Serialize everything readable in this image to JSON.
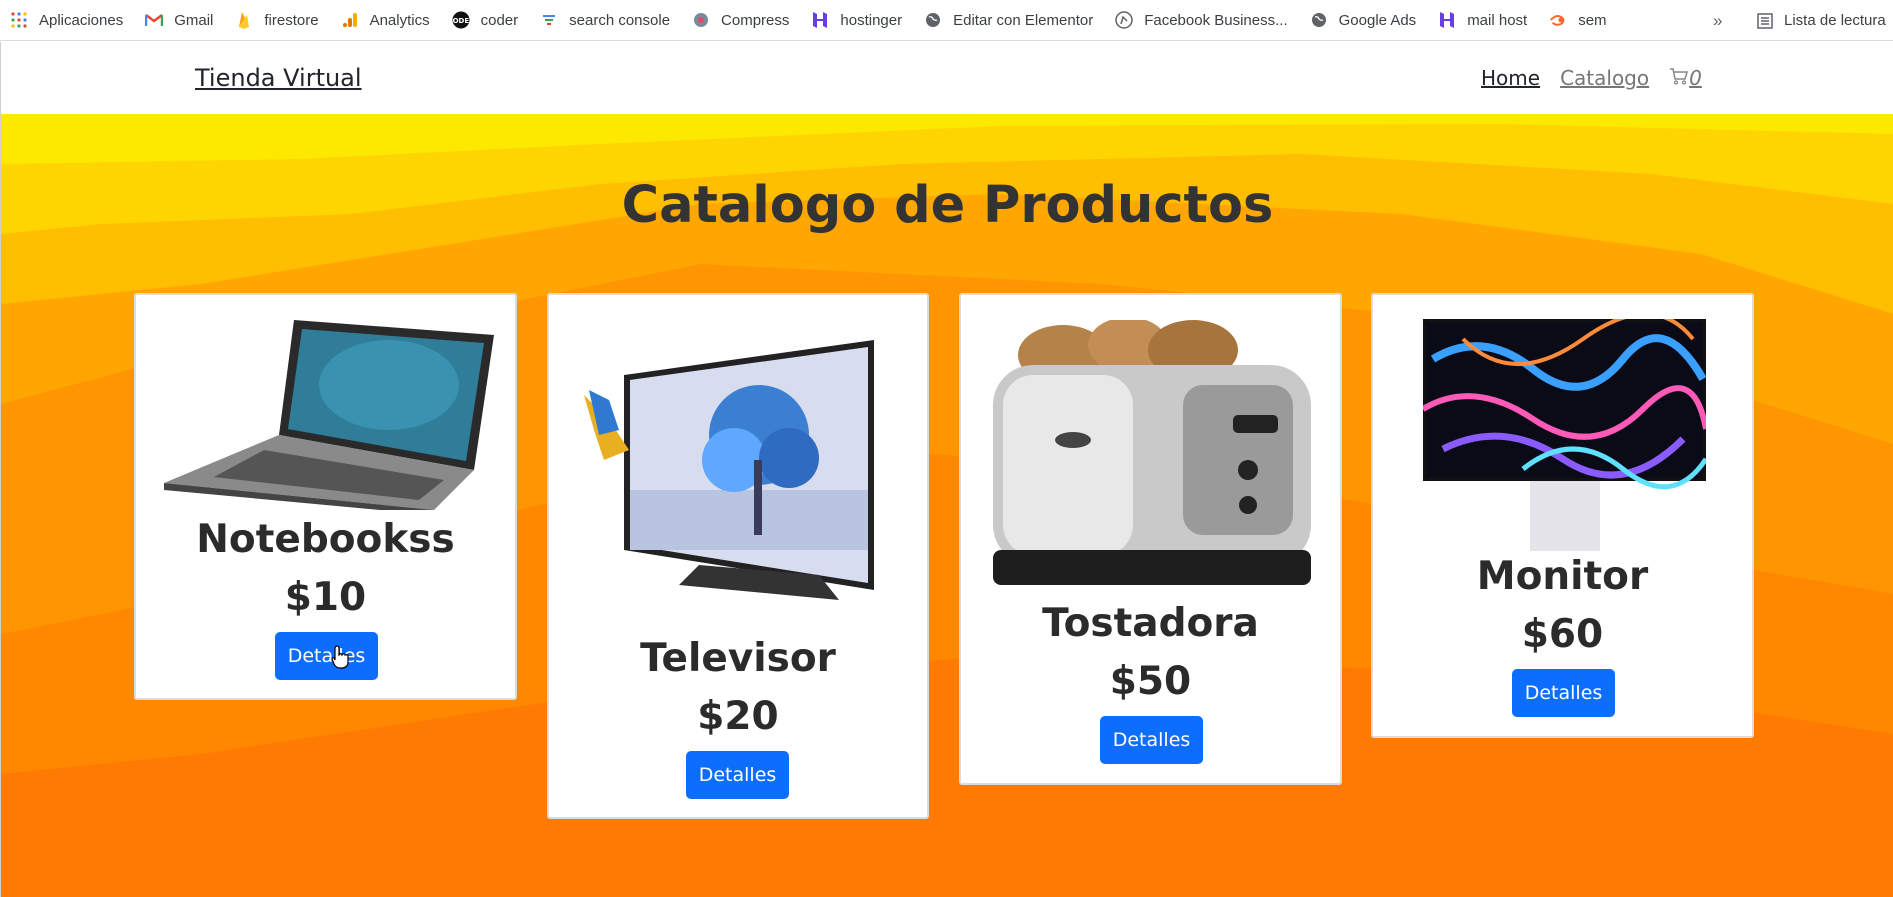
{
  "bookmarks": {
    "items": [
      {
        "label": "Aplicaciones",
        "icon": "apps-grid-icon"
      },
      {
        "label": "Gmail",
        "icon": "gmail-icon"
      },
      {
        "label": "firestore",
        "icon": "firebase-icon"
      },
      {
        "label": "Analytics",
        "icon": "analytics-icon"
      },
      {
        "label": "coder",
        "icon": "coder-icon"
      },
      {
        "label": "search console",
        "icon": "search-console-icon"
      },
      {
        "label": "Compress",
        "icon": "compress-icon"
      },
      {
        "label": "hostinger",
        "icon": "hostinger-icon"
      },
      {
        "label": "Editar con Elementor",
        "icon": "globe-icon"
      },
      {
        "label": "Facebook Business...",
        "icon": "facebook-business-icon"
      },
      {
        "label": "Google Ads",
        "icon": "globe-icon"
      },
      {
        "label": "mail host",
        "icon": "hostinger-icon"
      },
      {
        "label": "sem",
        "icon": "semrush-icon"
      }
    ],
    "more": "»",
    "reading_list": "Lista de lectura"
  },
  "nav": {
    "brand": "Tienda Virtual",
    "home": "Home",
    "catalog": "Catalogo",
    "cart_count": "0"
  },
  "page": {
    "title": "Catalogo de Productos"
  },
  "products": [
    {
      "name": "Notebookss",
      "price": "$10",
      "button": "Detalles",
      "image": "laptop-image"
    },
    {
      "name": "Televisor",
      "price": "$20",
      "button": "Detalles",
      "image": "television-image"
    },
    {
      "name": "Tostadora",
      "price": "$50",
      "button": "Detalles",
      "image": "toaster-image"
    },
    {
      "name": "Monitor",
      "price": "$60",
      "button": "Detalles",
      "image": "monitor-image"
    }
  ],
  "colors": {
    "primary_button": "#0d6efd",
    "hero_yellow": "#fde800",
    "hero_orange": "#fe7a00"
  }
}
